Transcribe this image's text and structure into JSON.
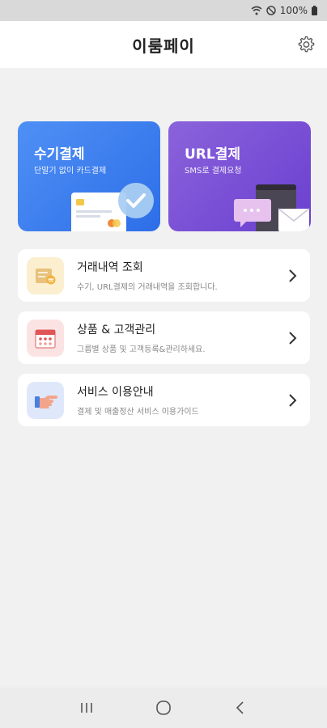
{
  "status": {
    "battery": "100%"
  },
  "app": {
    "title": "이룸페이"
  },
  "cards": [
    {
      "title": "수기결제",
      "subtitle": "단말기 없이 카드결제",
      "color": "#3d7ff0"
    },
    {
      "title": "URL결제",
      "subtitle": "SMS로 결제요청",
      "color": "#7a4fd8"
    }
  ],
  "menu": [
    {
      "title": "거래내역 조회",
      "desc": "수기, URL결제의 거래내역을 조회합니다.",
      "icon": "receipt-icon",
      "icon_bg": "#fbefd0"
    },
    {
      "title": "상품 & 고객관리",
      "desc": "그룹별 상품 및 고객등록&관리하세요.",
      "icon": "calendar-icon",
      "icon_bg": "#fbe3e3"
    },
    {
      "title": "서비스 이용안내",
      "desc": "결제 및 매출정산 서비스 이용가이드",
      "icon": "pointing-hand-icon",
      "icon_bg": "#dfe8fb"
    }
  ]
}
